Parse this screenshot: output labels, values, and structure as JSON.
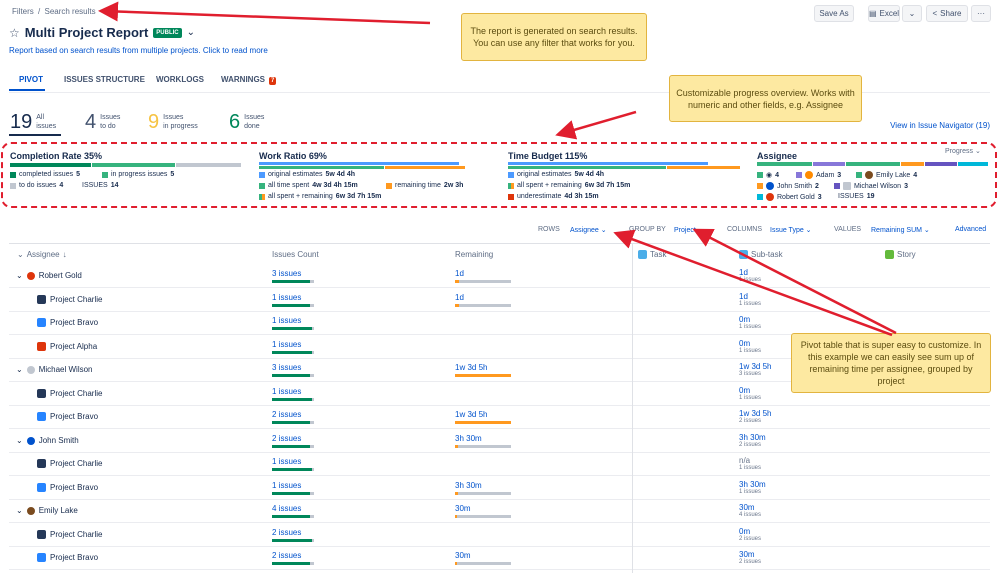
{
  "breadcrumbs": {
    "first": "Filters",
    "sep": "/",
    "second": "Search results"
  },
  "header": {
    "title": "Multi Project Report",
    "badge": "PUBLIC",
    "subtitle": "Report based on search results from multiple projects. Click to read more",
    "buttons": {
      "save_as": "Save As",
      "excel": "Excel",
      "share": "Share"
    }
  },
  "tabs": [
    {
      "label": "PIVOT"
    },
    {
      "label": "ISSUES STRUCTURE"
    },
    {
      "label": "WORKLOGS"
    },
    {
      "label": "WARNINGS",
      "badge": "7"
    }
  ],
  "stats": [
    {
      "num": "19",
      "l1": "All",
      "l2": "issues",
      "color": "#172b4d"
    },
    {
      "num": "4",
      "l1": "Issues",
      "l2": "to do",
      "color": "#42526e"
    },
    {
      "num": "9",
      "l1": "Issues",
      "l2": "in progress",
      "color": "#f6c343"
    },
    {
      "num": "6",
      "l1": "Issues",
      "l2": "done",
      "color": "#00875a"
    }
  ],
  "view_navigator": "View in Issue Navigator (19)",
  "summary": {
    "completion": {
      "label": "Completion Rate",
      "value": "35%",
      "l1": "completed issues",
      "v1": "5",
      "l2": "in progress issues",
      "v2": "5",
      "l3": "to do issues",
      "v3": "4",
      "l4": "ISSUES",
      "v4": "14"
    },
    "work_ratio": {
      "label": "Work Ratio",
      "value": "69%",
      "l1": "original estimates",
      "v1": "5w 4d 4h",
      "l2": "all time spent",
      "v2": "4w 3d 4h 15m",
      "l3": "remaining time",
      "v3": "2w 3h",
      "l4": "all spent + remaining",
      "v4": "6w 3d 7h 15m"
    },
    "time_budget": {
      "label": "Time Budget",
      "value": "115%",
      "l1": "original estimates",
      "v1": "5w 4d 4h",
      "l2": "all spent + remaining",
      "v2": "6w 3d 7h 15m",
      "l3": "underestimate",
      "v3": "4d 3h 15m"
    },
    "assignee": {
      "label": "Assignee",
      "progress_label": "Progress",
      "items": [
        {
          "name": "",
          "count": "4"
        },
        {
          "name": "Adam",
          "count": "3"
        },
        {
          "name": "Emily Lake",
          "count": "4"
        },
        {
          "name": "John Smith",
          "count": "2"
        },
        {
          "name": "Michael Wilson",
          "count": "3"
        },
        {
          "name": "Robert Gold",
          "count": "3"
        }
      ],
      "issues_label": "ISSUES",
      "issues_value": "19"
    }
  },
  "controls": {
    "rows_label": "ROWS",
    "rows_value": "Assignee",
    "group_label": "GROUP BY",
    "group_value": "Project",
    "columns_label": "COLUMNS",
    "columns_value": "Issue Type",
    "values_label": "VALUES",
    "values_value": "Remaining SUM",
    "advanced": "Advanced"
  },
  "table": {
    "headers": {
      "assignee": "Assignee",
      "count": "Issues Count",
      "remaining": "Remaining",
      "task": "Task",
      "subtask": "Sub-task",
      "story": "Story"
    },
    "rows": [
      {
        "type": "group",
        "name": "Robert Gold",
        "count": "3 issues",
        "rem": "1d",
        "st": "1d",
        "stsub": "1 issues",
        "pct": 0.9,
        "rpct": 0.08
      },
      {
        "type": "child",
        "name": "Project Charlie",
        "icon": "charlie",
        "count": "1 issues",
        "rem": "1d",
        "st": "1d",
        "stsub": "1 issues",
        "pct": 0.9,
        "rpct": 0.08
      },
      {
        "type": "child",
        "name": "Project Bravo",
        "icon": "bravo",
        "count": "1 issues",
        "rem": "",
        "st": "0m",
        "stsub": "1 issues",
        "pct": 0.95,
        "rpct": 0
      },
      {
        "type": "child",
        "name": "Project Alpha",
        "icon": "alpha",
        "count": "1 issues",
        "rem": "",
        "st": "0m",
        "stsub": "1 issues",
        "pct": 0.95,
        "rpct": 0
      },
      {
        "type": "group",
        "name": "Michael Wilson",
        "count": "3 issues",
        "rem": "1w 3d 5h",
        "st": "1w 3d 5h",
        "stsub": "3 issues",
        "pct": 0.9,
        "rpct": 1
      },
      {
        "type": "child",
        "name": "Project Charlie",
        "icon": "charlie",
        "count": "1 issues",
        "rem": "",
        "st": "0m",
        "stsub": "1 issues",
        "pct": 0.95,
        "rpct": 0
      },
      {
        "type": "child",
        "name": "Project Bravo",
        "icon": "bravo",
        "count": "2 issues",
        "rem": "1w 3d 5h",
        "st": "1w 3d 5h",
        "stsub": "2 issues",
        "pct": 0.9,
        "rpct": 1
      },
      {
        "type": "group",
        "name": "John Smith",
        "count": "2 issues",
        "rem": "3h 30m",
        "st": "3h 30m",
        "stsub": "2 issues",
        "pct": 0.9,
        "rpct": 0.05
      },
      {
        "type": "child",
        "name": "Project Charlie",
        "icon": "charlie",
        "count": "1 issues",
        "rem": "",
        "st": "n/a",
        "stsub": "1 issues",
        "pct": 0.95,
        "rpct": 0
      },
      {
        "type": "child",
        "name": "Project Bravo",
        "icon": "bravo",
        "count": "1 issues",
        "rem": "3h 30m",
        "st": "3h 30m",
        "stsub": "1 issues",
        "pct": 0.9,
        "rpct": 0.05
      },
      {
        "type": "group",
        "name": "Emily Lake",
        "count": "4 issues",
        "rem": "30m",
        "st": "30m",
        "stsub": "4 issues",
        "pct": 0.9,
        "rpct": 0.03
      },
      {
        "type": "child",
        "name": "Project Charlie",
        "icon": "charlie",
        "count": "2 issues",
        "rem": "",
        "st": "0m",
        "stsub": "2 issues",
        "pct": 0.95,
        "rpct": 0
      },
      {
        "type": "child",
        "name": "Project Bravo",
        "icon": "bravo",
        "count": "2 issues",
        "rem": "30m",
        "st": "30m",
        "stsub": "2 issues",
        "pct": 0.9,
        "rpct": 0.03
      }
    ]
  },
  "annotations": {
    "note1": "The report is generated on search results. You can use any filter that works for you.",
    "note2": "Customizable progress overview. Works with numeric and other fields, e.g. Assignee",
    "note3": "Pivot table that is super easy to customize. In this example we can easily see sum up of remaining time per assignee, grouped by project"
  },
  "colors": {
    "done": "#00875a",
    "progress": "#36b37e",
    "todo": "#c1c7d0",
    "blue": "#4c9aff",
    "orange": "#ff991f",
    "red": "#de350b",
    "accent": "#0052cc",
    "annotation_red": "#e01e2e"
  }
}
